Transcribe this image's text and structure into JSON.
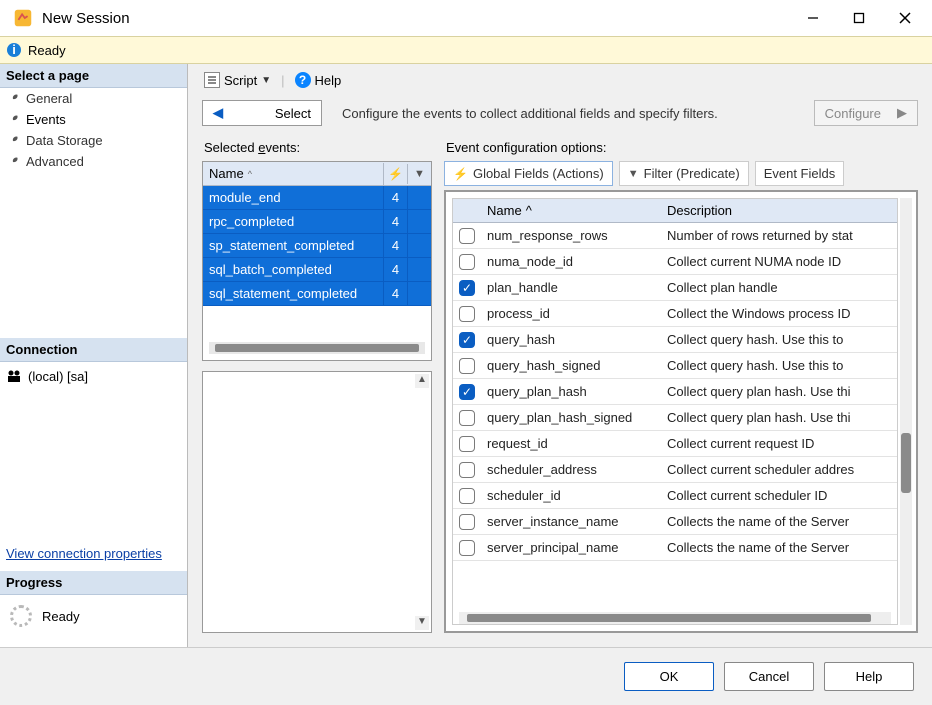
{
  "window": {
    "title": "New Session"
  },
  "infobar": {
    "text": "Ready"
  },
  "sidebar": {
    "header": "Select a page",
    "pages": [
      "General",
      "Events",
      "Data Storage",
      "Advanced"
    ],
    "activeIndex": 1,
    "connectionHeader": "Connection",
    "connection": "(local) [sa]",
    "connectionLink": "View connection properties",
    "progressHeader": "Progress",
    "progressText": "Ready"
  },
  "toolbar": {
    "script": "Script",
    "help": "Help"
  },
  "wizard": {
    "selectLabel": "Select",
    "description": "Configure the events to collect additional fields and specify filters.",
    "configureLabel": "Configure"
  },
  "eventsPanel": {
    "title": "Selected events:",
    "nameHeader": "Name",
    "rows": [
      {
        "name": "module_end",
        "count": "4"
      },
      {
        "name": "rpc_completed",
        "count": "4"
      },
      {
        "name": "sp_statement_completed",
        "count": "4"
      },
      {
        "name": "sql_batch_completed",
        "count": "4"
      },
      {
        "name": "sql_statement_completed",
        "count": "4"
      }
    ]
  },
  "configPanel": {
    "title": "Event configuration options:",
    "tabs": [
      "Global Fields (Actions)",
      "Filter (Predicate)",
      "Event Fields"
    ],
    "colName": "Name",
    "colDesc": "Description",
    "rows": [
      {
        "checked": false,
        "name": "num_response_rows",
        "desc": "Number of rows returned by stat"
      },
      {
        "checked": false,
        "name": "numa_node_id",
        "desc": "Collect current NUMA node ID"
      },
      {
        "checked": true,
        "name": "plan_handle",
        "desc": "Collect plan handle"
      },
      {
        "checked": false,
        "name": "process_id",
        "desc": "Collect the Windows process ID"
      },
      {
        "checked": true,
        "name": "query_hash",
        "desc": "Collect query hash. Use this to"
      },
      {
        "checked": false,
        "name": "query_hash_signed",
        "desc": "Collect query hash. Use this to"
      },
      {
        "checked": true,
        "name": "query_plan_hash",
        "desc": "Collect query plan hash. Use thi"
      },
      {
        "checked": false,
        "name": "query_plan_hash_signed",
        "desc": "Collect query plan hash. Use thi"
      },
      {
        "checked": false,
        "name": "request_id",
        "desc": "Collect current request ID"
      },
      {
        "checked": false,
        "name": "scheduler_address",
        "desc": "Collect current scheduler addres"
      },
      {
        "checked": false,
        "name": "scheduler_id",
        "desc": "Collect current scheduler ID"
      },
      {
        "checked": false,
        "name": "server_instance_name",
        "desc": "Collects the name of the Server"
      },
      {
        "checked": false,
        "name": "server_principal_name",
        "desc": "Collects the name of the Server"
      }
    ]
  },
  "footer": {
    "ok": "OK",
    "cancel": "Cancel",
    "help": "Help"
  }
}
